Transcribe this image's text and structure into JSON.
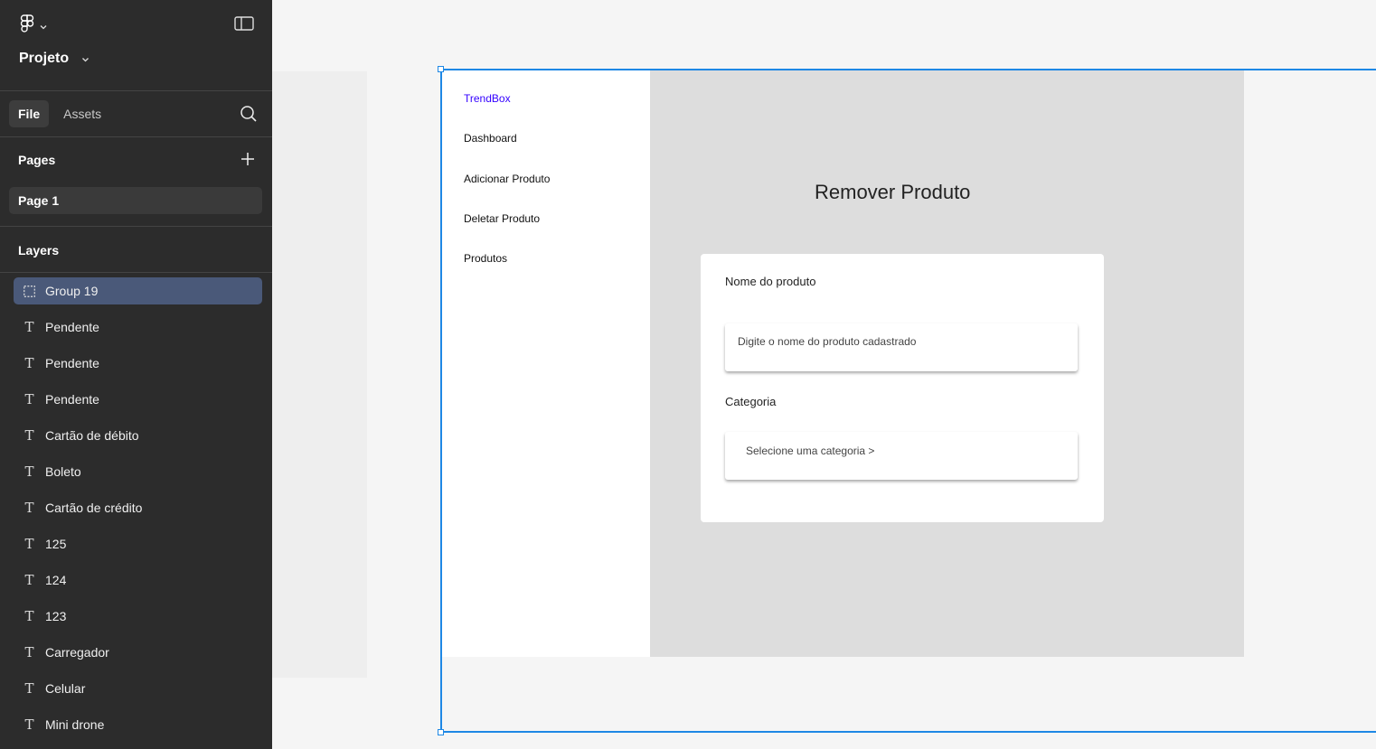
{
  "app": {
    "project_name": "Projeto"
  },
  "tabs": [
    {
      "label": "File",
      "active": true
    },
    {
      "label": "Assets",
      "active": false
    }
  ],
  "pages_section": {
    "title": "Pages",
    "pages": [
      {
        "label": "Page 1",
        "selected": true
      }
    ]
  },
  "layers_section": {
    "title": "Layers",
    "layers": [
      {
        "icon": "group-icon",
        "label": "Group 19",
        "selected": true
      },
      {
        "icon": "text-icon",
        "label": "Pendente"
      },
      {
        "icon": "text-icon",
        "label": "Pendente"
      },
      {
        "icon": "text-icon",
        "label": "Pendente"
      },
      {
        "icon": "text-icon",
        "label": "Cartão de débito"
      },
      {
        "icon": "text-icon",
        "label": "Boleto"
      },
      {
        "icon": "text-icon",
        "label": "Cartão de crédito"
      },
      {
        "icon": "text-icon",
        "label": "125"
      },
      {
        "icon": "text-icon",
        "label": "124"
      },
      {
        "icon": "text-icon",
        "label": "123"
      },
      {
        "icon": "text-icon",
        "label": "Carregador"
      },
      {
        "icon": "text-icon",
        "label": "Celular"
      },
      {
        "icon": "text-icon",
        "label": "Mini drone"
      }
    ]
  },
  "design": {
    "brand": "TrendBox",
    "nav": [
      "Dashboard",
      "Adicionar Produto",
      "Deletar Produto",
      "Produtos"
    ],
    "heading": "Remover Produto",
    "form": {
      "product_label": "Nome do produto",
      "product_placeholder": "Digite o nome do produto cadastrado",
      "category_label": "Categoria",
      "category_select": "Selecione uma categoria >"
    }
  },
  "colors": {
    "sidebar_bg": "#2c2c2c",
    "selection_blue": "#1e88e5",
    "selected_layer_bg": "#4a5979",
    "brand_link": "#3300ff",
    "main_panel_bg": "#dddddd"
  }
}
